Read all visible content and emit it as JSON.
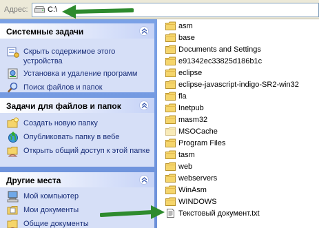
{
  "address_bar": {
    "label": "Адрес:",
    "value": "C:\\"
  },
  "sidebar": {
    "panels": [
      {
        "title": "Системные задачи",
        "items": [
          {
            "label": "Скрыть содержимое этого устройства",
            "icon": "hide-drive-icon"
          },
          {
            "label": "Установка и удаление программ",
            "icon": "add-remove-programs-icon"
          },
          {
            "label": "Поиск файлов и папок",
            "icon": "search-icon"
          }
        ]
      },
      {
        "title": "Задачи для файлов и папок",
        "items": [
          {
            "label": "Создать новую папку",
            "icon": "new-folder-icon"
          },
          {
            "label": "Опубликовать папку в вебе",
            "icon": "publish-web-icon"
          },
          {
            "label": "Открыть общий доступ к этой папке",
            "icon": "share-folder-icon"
          }
        ]
      },
      {
        "title": "Другие места",
        "items": [
          {
            "label": "Мой компьютер",
            "icon": "my-computer-icon"
          },
          {
            "label": "Мои документы",
            "icon": "my-documents-icon"
          },
          {
            "label": "Общие документы",
            "icon": "shared-documents-icon"
          }
        ]
      }
    ]
  },
  "files": [
    {
      "name": "asm",
      "type": "folder"
    },
    {
      "name": "base",
      "type": "folder"
    },
    {
      "name": "Documents and Settings",
      "type": "folder"
    },
    {
      "name": "e91342ec33825d186b1c",
      "type": "folder"
    },
    {
      "name": "eclipse",
      "type": "folder"
    },
    {
      "name": "eclipse-javascript-indigo-SR2-win32",
      "type": "folder"
    },
    {
      "name": "fla",
      "type": "folder"
    },
    {
      "name": "Inetpub",
      "type": "folder"
    },
    {
      "name": "masm32",
      "type": "folder"
    },
    {
      "name": "MSOCache",
      "type": "folder-hidden"
    },
    {
      "name": "Program Files",
      "type": "folder"
    },
    {
      "name": "tasm",
      "type": "folder"
    },
    {
      "name": "web",
      "type": "folder"
    },
    {
      "name": "webservers",
      "type": "folder"
    },
    {
      "name": "WinAsm",
      "type": "folder"
    },
    {
      "name": "WINDOWS",
      "type": "folder"
    },
    {
      "name": "Текстовый документ.txt",
      "type": "text-file"
    }
  ],
  "colors": {
    "sidebar_bg": "#7aa1e6",
    "panel_bg": "#d6dff7",
    "link_text": "#1a2f7a",
    "folder": "#f5d56b",
    "arrow": "#2e8b2e"
  }
}
